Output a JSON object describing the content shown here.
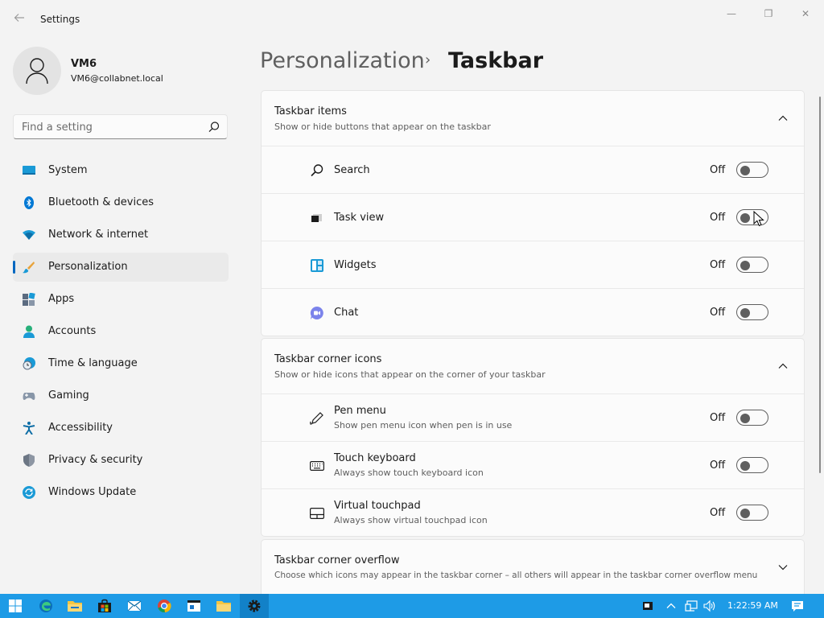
{
  "window": {
    "title": "Settings",
    "back_icon": "back-arrow-icon",
    "minimize_glyph": "—",
    "maximize_glyph": "❐",
    "close_glyph": "✕"
  },
  "user": {
    "name": "VM6",
    "email": "VM6@collabnet.local"
  },
  "search": {
    "placeholder": "Find a setting",
    "value": ""
  },
  "sidebar": {
    "items": [
      {
        "label": "System",
        "icon": "system-icon"
      },
      {
        "label": "Bluetooth & devices",
        "icon": "bluetooth-icon"
      },
      {
        "label": "Network & internet",
        "icon": "network-icon"
      },
      {
        "label": "Personalization",
        "icon": "personalization-icon",
        "selected": true
      },
      {
        "label": "Apps",
        "icon": "apps-icon"
      },
      {
        "label": "Accounts",
        "icon": "accounts-icon"
      },
      {
        "label": "Time & language",
        "icon": "time-language-icon"
      },
      {
        "label": "Gaming",
        "icon": "gaming-icon"
      },
      {
        "label": "Accessibility",
        "icon": "accessibility-icon"
      },
      {
        "label": "Privacy & security",
        "icon": "privacy-icon"
      },
      {
        "label": "Windows Update",
        "icon": "windows-update-icon"
      }
    ]
  },
  "header": {
    "parent": "Personalization",
    "separator": "›",
    "current": "Taskbar"
  },
  "sections": {
    "taskbar_items": {
      "title": "Taskbar items",
      "subtitle": "Show or hide buttons that appear on the taskbar",
      "expanded": true,
      "rows": [
        {
          "label": "Search",
          "state": "Off",
          "icon": "search-icon"
        },
        {
          "label": "Task view",
          "state": "Off",
          "icon": "task-view-icon"
        },
        {
          "label": "Widgets",
          "state": "Off",
          "icon": "widgets-icon"
        },
        {
          "label": "Chat",
          "state": "Off",
          "icon": "chat-icon"
        }
      ]
    },
    "corner_icons": {
      "title": "Taskbar corner icons",
      "subtitle": "Show or hide icons that appear on the corner of your taskbar",
      "expanded": true,
      "rows": [
        {
          "label": "Pen menu",
          "desc": "Show pen menu icon when pen is in use",
          "state": "Off",
          "icon": "pen-icon"
        },
        {
          "label": "Touch keyboard",
          "desc": "Always show touch keyboard icon",
          "state": "Off",
          "icon": "keyboard-icon"
        },
        {
          "label": "Virtual touchpad",
          "desc": "Always show virtual touchpad icon",
          "state": "Off",
          "icon": "touchpad-icon"
        }
      ]
    },
    "corner_overflow": {
      "title": "Taskbar corner overflow",
      "subtitle": "Choose which icons may appear in the taskbar corner – all others will appear in the taskbar corner overflow menu",
      "expanded": false
    }
  },
  "taskbar": {
    "clock": "1:22:59 AM",
    "apps": [
      "start-icon",
      "edge-icon",
      "file-explorer-icon",
      "store-icon",
      "mail-icon",
      "chrome-icon",
      "terminal-icon",
      "folder-icon",
      "settings-icon"
    ],
    "tray": [
      "keyboard-layout-icon",
      "chevron-up-icon",
      "network-icon",
      "volume-icon",
      "notification-icon"
    ]
  },
  "colors": {
    "accent": "#0067c0",
    "taskbar": "#1e9be6",
    "background": "#f3f3f3",
    "card": "#fbfbfb"
  }
}
